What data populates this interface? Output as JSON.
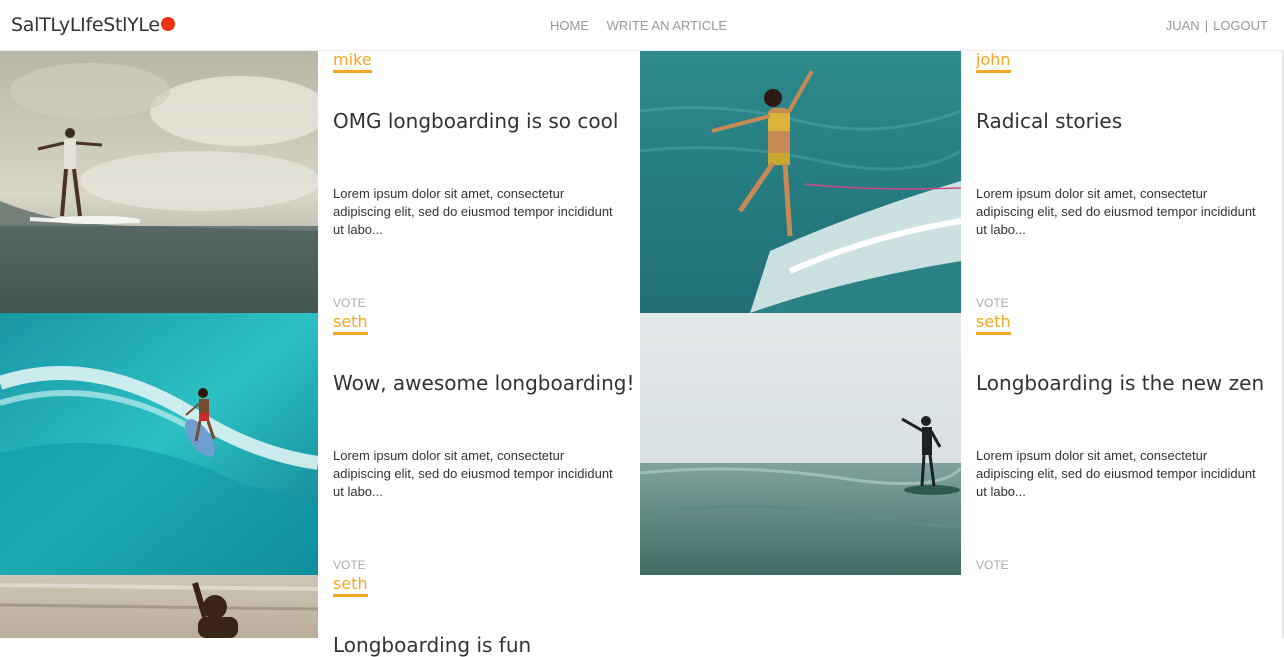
{
  "brand": {
    "name": "SalTLyLIfeStlYLe",
    "dot_color": "#ee3311"
  },
  "nav": {
    "home": "HOME",
    "write": "WRITE AN ARTICLE"
  },
  "user": {
    "name": "JUAN",
    "separator": "|",
    "logout": "LOGOUT"
  },
  "accent": "#f5a623",
  "articles": [
    {
      "author": "mike",
      "title": "OMG longboarding is so cool",
      "excerpt": "Lorem ipsum dolor sit amet, consectetur adipiscing elit, sed do eiusmod tempor incididunt ut labo...",
      "vote": "VOTE"
    },
    {
      "author": "john",
      "title": "Radical stories",
      "excerpt": "Lorem ipsum dolor sit amet, consectetur adipiscing elit, sed do eiusmod tempor incididunt ut labo...",
      "vote": "VOTE"
    },
    {
      "author": "seth",
      "title": "Wow, awesome longboarding!",
      "excerpt": "Lorem ipsum dolor sit amet, consectetur adipiscing elit, sed do eiusmod tempor incididunt ut labo...",
      "vote": "VOTE"
    },
    {
      "author": "seth",
      "title": "Longboarding is the new zen",
      "excerpt": "Lorem ipsum dolor sit amet, consectetur adipiscing elit, sed do eiusmod tempor incididunt ut labo...",
      "vote": "VOTE"
    },
    {
      "author": "seth",
      "title": "Longboarding is fun",
      "excerpt": "",
      "vote": ""
    }
  ]
}
